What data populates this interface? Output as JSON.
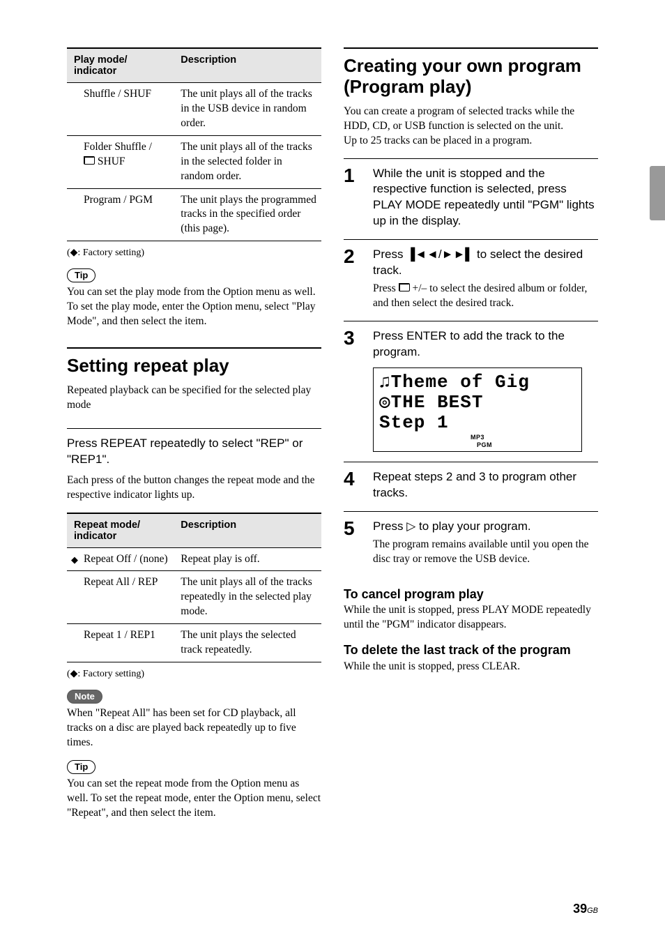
{
  "left": {
    "table1": {
      "h1": "Play mode/ indicator",
      "h2": "Description",
      "rows": [
        {
          "mode": "Shuffle / SHUF",
          "desc": "The unit plays all of the tracks in the USB device in random order."
        },
        {
          "mode": "Folder Shuffle / ",
          "mode_suffix": " SHUF",
          "folder_icon": true,
          "desc": "The unit plays all of the tracks in the selected folder in random order."
        },
        {
          "mode": "Program / PGM",
          "desc": "The unit plays the programmed tracks in the specified order (this page)."
        }
      ]
    },
    "factory": "(◆: Factory setting)",
    "tip_label": "Tip",
    "tip1": "You can set the play mode from the Option menu as well. To set the play mode, enter the Option menu, select \"Play Mode\", and then select the item.",
    "h2_repeat": "Setting repeat play",
    "repeat_intro": "Repeated playback can be specified for the selected play mode",
    "repeat_step": "Press REPEAT repeatedly to select \"REP\" or \"REP1\".",
    "repeat_desc": "Each press of the button changes the repeat mode and the respective indicator lights up.",
    "table2": {
      "h1": "Repeat mode/ indicator",
      "h2": "Description",
      "rows": [
        {
          "mode": "Repeat Off / (none)",
          "default": true,
          "desc": "Repeat play is off."
        },
        {
          "mode": "Repeat All / REP",
          "desc": "The unit plays all of the tracks repeatedly in the selected play mode."
        },
        {
          "mode": "Repeat 1 / REP1",
          "desc": "The unit plays the selected track repeatedly."
        }
      ]
    },
    "note_label": "Note",
    "note_text": "When \"Repeat All\" has been set for CD playback, all tracks on a disc are played back repeatedly up to five times.",
    "tip2": "You can set the repeat mode from the Option menu as well. To set the repeat mode, enter the Option menu, select \"Repeat\", and then select the item."
  },
  "right": {
    "h2_prog": "Creating your own program (Program play)",
    "prog_intro1": "You can create a program of selected tracks while the HDD, CD, or USB function is selected on the unit.",
    "prog_intro2": "Up to 25 tracks can be placed in a program.",
    "steps": [
      {
        "n": "1",
        "head": "While the unit is stopped and the respective function is selected, press PLAY MODE repeatedly until \"PGM\" lights up in the display."
      },
      {
        "n": "2",
        "head_pre": "Press ",
        "head_post": " to select the desired track.",
        "sub_pre": "Press ",
        "sub_post": " +/– to select the desired album or folder, and then select the desired track."
      },
      {
        "n": "3",
        "head": "Press ENTER to add the track to the program.",
        "display": {
          "l1": "♫Theme of Gig",
          "l2": "◎THE BEST",
          "l3": "Step 1",
          "s1": "MP3",
          "s2": "PGM"
        }
      },
      {
        "n": "4",
        "head": "Repeat steps 2 and 3 to program other tracks."
      },
      {
        "n": "5",
        "head_pre": "Press ",
        "head_post": " to play your program.",
        "sub": "The program remains available until you open the disc tray or remove the USB device."
      }
    ],
    "cancel_h": "To cancel program play",
    "cancel_t": "While the unit is stopped, press PLAY MODE repeatedly until the \"PGM\" indicator disappears.",
    "delete_h": "To delete the last track of the program",
    "delete_t": "While the unit is stopped, press CLEAR."
  },
  "page_number": "39",
  "page_suffix": "GB"
}
